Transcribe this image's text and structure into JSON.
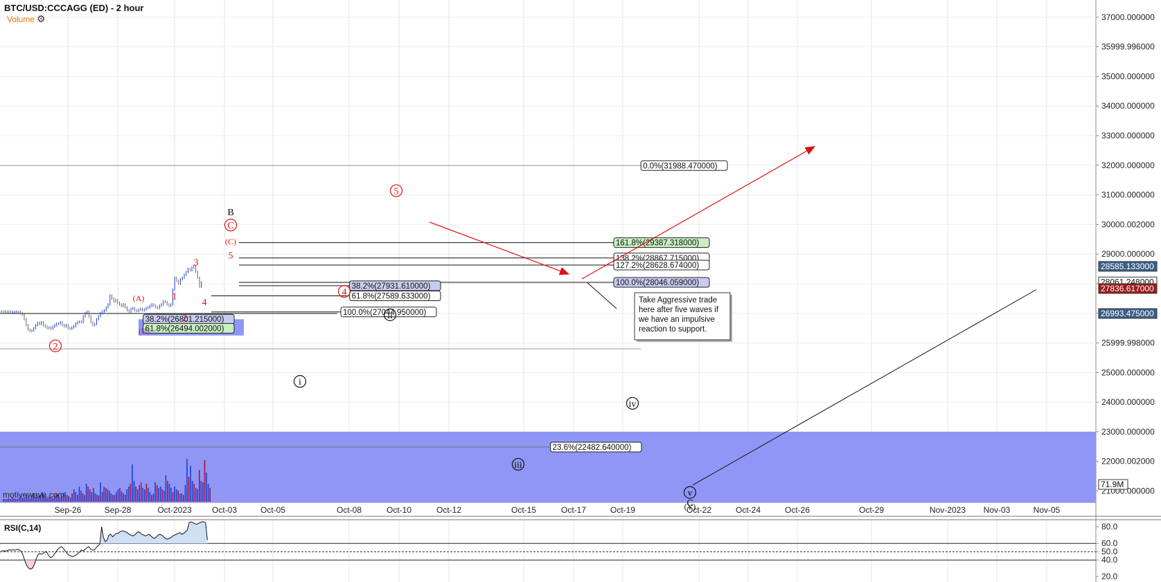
{
  "header": {
    "symbol_title": "BTC/USD:CCCAGG (ED) - 2 hour",
    "volume_label": "Volume",
    "watermark": "motivewave.com"
  },
  "colors": {
    "up_bar": "#1f3fd0",
    "down_bar": "#b0103a",
    "support_zone": "#8f96f5",
    "small_zone": "#8f96f5",
    "wave_red": "#e01010",
    "label_green": "#c8f0c0",
    "label_blue": "#c8ccf0",
    "price_blue": "#3c5f8a",
    "price_red": "#9b1c1c",
    "rsi_up_fill": "#cfe0f5",
    "rsi_down_fill": "#f5d0d8"
  },
  "chart_data": {
    "type": "ohlc",
    "timeframe": "2 hour",
    "price_axis": {
      "labels": [
        "37000.000000",
        "35999.996000",
        "35000.000000",
        "34000.000000",
        "33000.000000",
        "32000.000000",
        "31000.000000",
        "30000.002000",
        "29000.000000",
        "28000.000000",
        "27000.000000",
        "25999.998000",
        "25000.000000",
        "24000.000000",
        "23000.000000",
        "22000.002000",
        "21000.000000"
      ],
      "values": [
        37000,
        36000,
        35000,
        34000,
        33000,
        32000,
        31000,
        30000,
        29000,
        28000,
        27000,
        26000,
        25000,
        24000,
        23000,
        22000,
        21000
      ],
      "range": [
        20450,
        37300
      ]
    },
    "time_axis": [
      "Sep-26",
      "Sep-28",
      "Oct-2023",
      "Oct-03",
      "Oct-05",
      "Oct-08",
      "Oct-10",
      "Oct-12",
      "Oct-15",
      "Oct-17",
      "Oct-19",
      "Oct-22",
      "Oct-24",
      "Oct-26",
      "Oct-29",
      "Nov-2023",
      "Nov-03",
      "Nov-05"
    ],
    "price_tags": [
      {
        "label": "28585.133000",
        "value": 28585.133,
        "style": "blue"
      },
      {
        "label": "28061.248000",
        "value": 28061.248,
        "style": "white"
      },
      {
        "label": "27836.617000",
        "value": 27836.617,
        "style": "red"
      },
      {
        "label": "26993.475000",
        "value": 26993.475,
        "style": "blue"
      },
      {
        "label": "71.9M",
        "value": 21000,
        "style": "white"
      }
    ],
    "fib_lines": [
      {
        "label": "0.0%(31988.470000)",
        "value": 31988.47,
        "style": "white"
      },
      {
        "label": "161.8%(29387.318000)",
        "value": 29387.318,
        "style": "green"
      },
      {
        "label": "138.2%(28867.715000)",
        "value": 28867.715,
        "style": "white"
      },
      {
        "label": "127.2%(28628.674000)",
        "value": 28628.674,
        "style": "white"
      },
      {
        "label": "100.0%(28046.059000)",
        "value": 28046.059,
        "style": "blue"
      },
      {
        "label": "38.2%(27931.610000)",
        "value": 27931.61,
        "style": "blue"
      },
      {
        "label": "61.8%(27589.633000)",
        "value": 27589.633,
        "style": "white"
      },
      {
        "label": "100.0%(27044.950000)",
        "value": 27044.95,
        "style": "white"
      },
      {
        "label": "38.2%(26801.215000)",
        "value": 26801.215,
        "style": "blue"
      },
      {
        "label": "61.8%(26494.002000)",
        "value": 26494.002,
        "style": "green"
      },
      {
        "label": "23.6%(22482.640000)",
        "value": 22482.64,
        "style": "white"
      }
    ],
    "horizontal_lines": [
      31988.47,
      25800
    ],
    "support_zone": {
      "low": 20450,
      "high": 23000
    },
    "wave_labels": [
      {
        "text": "2",
        "circled": true,
        "color": "red",
        "t": -170,
        "p": 25900
      },
      {
        "text": "(A)",
        "circled": false,
        "color": "red",
        "t": -50,
        "p": 27530
      },
      {
        "text": "(B)",
        "circled": false,
        "color": "purple",
        "t": -42,
        "p": 26420
      },
      {
        "text": "1",
        "circled": false,
        "color": "red",
        "t": 2,
        "p": 27590
      },
      {
        "text": "2",
        "circled": false,
        "color": "red",
        "t": 17,
        "p": 26850
      },
      {
        "text": "3",
        "circled": false,
        "color": "red",
        "t": 33,
        "p": 28740
      },
      {
        "text": "4",
        "circled": false,
        "color": "red",
        "t": 45,
        "p": 27390
      },
      {
        "text": "5",
        "circled": false,
        "color": "red",
        "t": 83,
        "p": 28970
      },
      {
        "text": "(C)",
        "circled": false,
        "color": "red",
        "t": 83,
        "p": 29450
      },
      {
        "text": "C",
        "circled": true,
        "color": "red",
        "t": 83,
        "p": 29980
      },
      {
        "text": "B",
        "circled": false,
        "color": "black",
        "t": 83,
        "p": 30430
      },
      {
        "text": "4",
        "circled": true,
        "color": "red",
        "t": 247,
        "p": 27740
      },
      {
        "text": "5",
        "circled": true,
        "color": "red",
        "t": 322,
        "p": 31140
      },
      {
        "text": "i",
        "circled": true,
        "color": "black",
        "t": 183,
        "p": 24700
      },
      {
        "text": "ii",
        "circled": true,
        "color": "black",
        "t": 313,
        "p": 26950
      },
      {
        "text": "iii",
        "circled": true,
        "color": "black",
        "t": 498,
        "p": 21900
      },
      {
        "text": "iv",
        "circled": true,
        "color": "black",
        "t": 663,
        "p": 23960
      },
      {
        "text": "v",
        "circled": true,
        "color": "black",
        "t": 746,
        "p": 20950
      },
      {
        "text": "C",
        "circled": false,
        "color": "black",
        "t": 746,
        "p": 20610
      },
      {
        "text": "(Y)",
        "circled": false,
        "color": "black",
        "t": 746,
        "p": 20500
      }
    ],
    "arrows": [
      {
        "from": {
          "t": 370,
          "p": 30080
        },
        "to": {
          "t": 570,
          "p": 28330
        },
        "color": "red"
      },
      {
        "from": {
          "t": 590,
          "p": 28160
        },
        "to": {
          "t": 925,
          "p": 32620
        },
        "color": "red"
      }
    ],
    "trendlines": [
      {
        "from": {
          "t": 750,
          "p": 21200
        },
        "to": {
          "t": 1246,
          "p": 27800
        },
        "color": "black"
      },
      {
        "from": {
          "t": 598,
          "p": 28030
        },
        "to": {
          "t": 640,
          "p": 27160
        },
        "color": "black"
      }
    ],
    "note": "Take Aggressive trade here after five waves if we have an impulsive reaction to support.",
    "rsi": {
      "title": "RSI(C,14)",
      "axis_labels": [
        "80.0",
        "60.0",
        "50.0",
        "40.0",
        "20.0"
      ],
      "axis_values": [
        80,
        60,
        50,
        40,
        20
      ],
      "range": [
        16,
        86
      ],
      "levels": [
        60,
        50,
        40
      ],
      "values": [
        51,
        51,
        51,
        51,
        52,
        52,
        52,
        52,
        52,
        53,
        52,
        50,
        45,
        38,
        33,
        30,
        29,
        30,
        34,
        41,
        46,
        48,
        47,
        48,
        50,
        49,
        45,
        43,
        44,
        47,
        50,
        53,
        55,
        56,
        54,
        51,
        48,
        46,
        45,
        44,
        45,
        46,
        48,
        50,
        52,
        51,
        53,
        55,
        56,
        53,
        52,
        52,
        55,
        57,
        59,
        80,
        67,
        62,
        64,
        70,
        71,
        68,
        70,
        72,
        72,
        74,
        75,
        75,
        74,
        73,
        71,
        70,
        69,
        70,
        72,
        74,
        73,
        71,
        70,
        69,
        70,
        71,
        69,
        67,
        66,
        68,
        70,
        71,
        70,
        68,
        66,
        65,
        66,
        67,
        69,
        70,
        71,
        72,
        73,
        71,
        72,
        74,
        76,
        85,
        86,
        85,
        84,
        83,
        84,
        85,
        86,
        86,
        85,
        64
      ]
    },
    "volume": {
      "label": "Volume",
      "last_label": "71.9M"
    }
  }
}
